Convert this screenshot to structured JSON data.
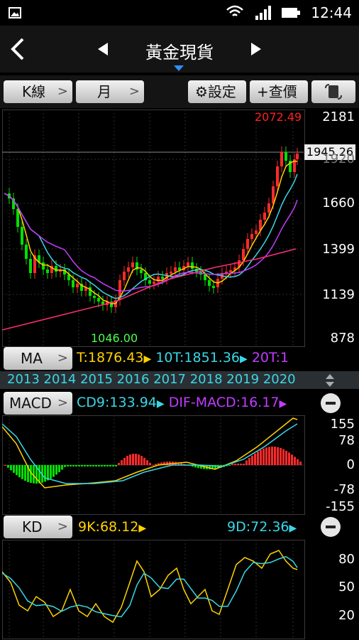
{
  "status": {
    "time": "12:44"
  },
  "header": {
    "title": "黃金現貨"
  },
  "toolbar": {
    "kline_label": "K線",
    "period_label": "月",
    "settings_label": "設定",
    "quote_label": "+查價"
  },
  "main_chart": {
    "high_label": "2072.49",
    "low_label": "1046.00",
    "current_label": "1945.26",
    "y_ticks": [
      "2181",
      "1920",
      "1660",
      "1399",
      "1139",
      "878"
    ]
  },
  "ma_row": {
    "button_label": "MA",
    "t_label": "T:1876.43",
    "t10_label": "10T:1851.36",
    "t20_label": "20T:1"
  },
  "years": [
    "2013",
    "2014",
    "2015",
    "2016",
    "2017",
    "2018",
    "2019",
    "2020"
  ],
  "macd_row": {
    "button_label": "MACD",
    "cd9_label": "CD9:133.94",
    "dif_label": "DIF-MACD:16.17"
  },
  "macd_ticks": [
    "155",
    "78",
    "0",
    "-78",
    "-155"
  ],
  "kd_row": {
    "button_label": "KD",
    "k_label": "9K:68.12",
    "d_label": "9D:72.36"
  },
  "kd_ticks": [
    "80",
    "50",
    "20"
  ],
  "colors": {
    "up": "#ff2a2a",
    "down": "#00e000",
    "ma_yellow": "#ffd200",
    "ma_cyan": "#3ad7e6",
    "ma_purple": "#c23cff",
    "ma_pink": "#ff2d7a"
  }
}
